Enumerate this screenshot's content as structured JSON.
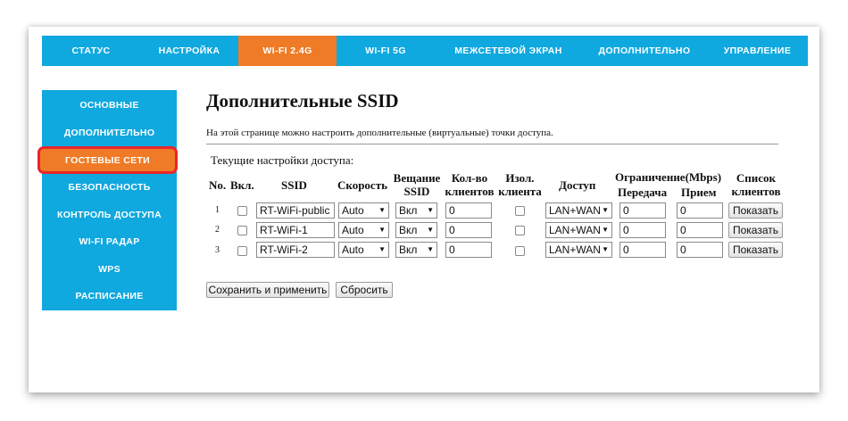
{
  "nav": {
    "tabs": [
      "СТАТУС",
      "НАСТРОЙКА",
      "WI-FI 2.4G",
      "WI-FI 5G",
      "МЕЖСЕТЕВОЙ ЭКРАН",
      "ДОПОЛНИТЕЛЬНО",
      "УПРАВЛЕНИЕ"
    ],
    "active_tab": "WI-FI 2.4G"
  },
  "sidebar": {
    "items": [
      "ОСНОВНЫЕ",
      "ДОПОЛНИТЕЛЬНО",
      "ГОСТЕВЫЕ СЕТИ",
      "БЕЗОПАСНОСТЬ",
      "КОНТРОЛЬ ДОСТУПА",
      "WI-FI РАДАР",
      "WPS",
      "РАСПИСАНИЕ"
    ],
    "active_item": "ГОСТЕВЫЕ СЕТИ"
  },
  "main": {
    "title": "Дополнительные SSID",
    "description": "На этой странице можно настроить дополнительные (виртуальные) точки доступа.",
    "section_label": "Текущие настройки доступа:",
    "headers": {
      "no": "No.",
      "enabled": "Вкл.",
      "ssid": "SSID",
      "speed": "Скорость",
      "broadcast_1": "Вещание",
      "broadcast_2": "SSID",
      "clients_1": "Кол-во",
      "clients_2": "клиентов",
      "isolation_1": "Изол.",
      "isolation_2": "клиента",
      "access": "Доступ",
      "limit": "Ограничение(Mbps)",
      "limit_tx": "Передача",
      "limit_rx": "Прием",
      "list_1": "Список",
      "list_2": "клиентов"
    },
    "rows": [
      {
        "no": "1",
        "ssid": "RT-WiFi-public",
        "speed": "Auto",
        "broadcast": "Вкл",
        "clients": "0",
        "access": "LAN+WAN",
        "tx": "0",
        "rx": "0",
        "show": "Показать"
      },
      {
        "no": "2",
        "ssid": "RT-WiFi-1",
        "speed": "Auto",
        "broadcast": "Вкл",
        "clients": "0",
        "access": "LAN+WAN",
        "tx": "0",
        "rx": "0",
        "show": "Показать"
      },
      {
        "no": "3",
        "ssid": "RT-WiFi-2",
        "speed": "Auto",
        "broadcast": "Вкл",
        "clients": "0",
        "access": "LAN+WAN",
        "tx": "0",
        "rx": "0",
        "show": "Показать"
      }
    ],
    "save_button": "Сохранить и применить",
    "reset_button": "Сбросить"
  },
  "colors": {
    "nav_bg": "#0fa8df",
    "active_bg": "#ef7b26",
    "highlight_border": "#e8262a"
  }
}
